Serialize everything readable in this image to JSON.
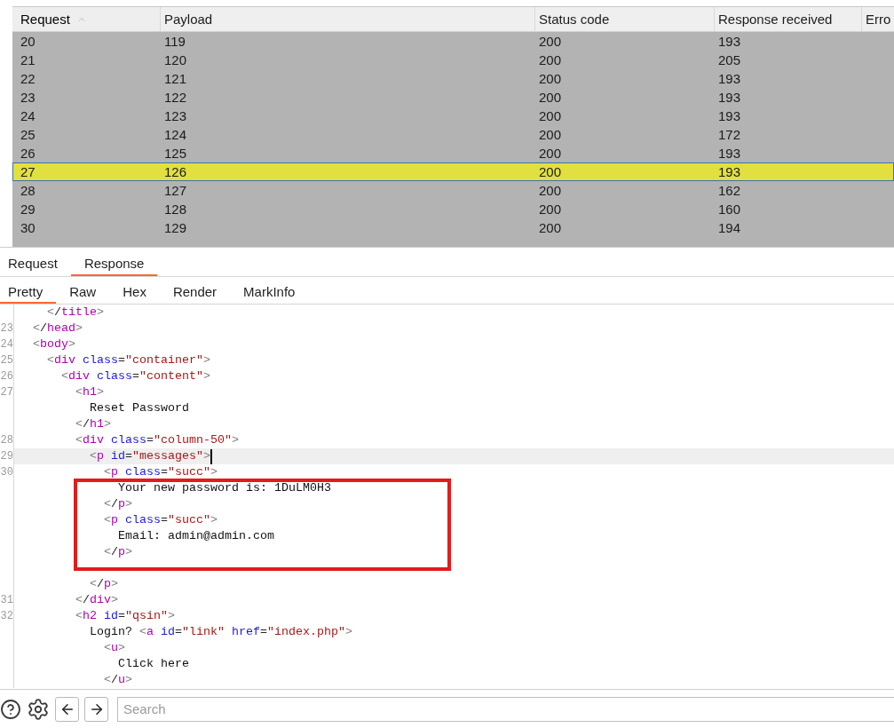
{
  "table": {
    "columns": [
      {
        "label": "Request",
        "sorted": true
      },
      {
        "label": "Payload",
        "sorted": false
      },
      {
        "label": "Status code",
        "sorted": false
      },
      {
        "label": "Response received",
        "sorted": false
      },
      {
        "label": "Erro",
        "sorted": false
      }
    ],
    "rows": [
      {
        "cells": [
          "20",
          "119",
          "200",
          "193"
        ],
        "selected": false
      },
      {
        "cells": [
          "21",
          "120",
          "200",
          "205"
        ],
        "selected": false
      },
      {
        "cells": [
          "22",
          "121",
          "200",
          "193"
        ],
        "selected": false
      },
      {
        "cells": [
          "23",
          "122",
          "200",
          "193"
        ],
        "selected": false
      },
      {
        "cells": [
          "24",
          "123",
          "200",
          "193"
        ],
        "selected": false
      },
      {
        "cells": [
          "25",
          "124",
          "200",
          "172"
        ],
        "selected": false
      },
      {
        "cells": [
          "26",
          "125",
          "200",
          "193"
        ],
        "selected": false
      },
      {
        "cells": [
          "27",
          "126",
          "200",
          "193"
        ],
        "selected": true
      },
      {
        "cells": [
          "28",
          "127",
          "200",
          "162"
        ],
        "selected": false
      },
      {
        "cells": [
          "29",
          "128",
          "200",
          "160"
        ],
        "selected": false
      },
      {
        "cells": [
          "30",
          "129",
          "200",
          "194"
        ],
        "selected": false
      }
    ]
  },
  "tabs": [
    {
      "label": "Request",
      "selected": false
    },
    {
      "label": "Response",
      "selected": true
    }
  ],
  "view_tabs": [
    {
      "label": "Pretty",
      "selected": true
    },
    {
      "label": "Raw",
      "selected": false
    },
    {
      "label": "Hex",
      "selected": false
    },
    {
      "label": "Render",
      "selected": false
    },
    {
      "label": "MarkInfo",
      "selected": false
    }
  ],
  "editor": {
    "lines": [
      {
        "tokens": [
          {
            "kind": "bracket",
            "text": "    <"
          },
          {
            "kind": "punct",
            "text": "/"
          },
          {
            "kind": "tag",
            "text": "title"
          },
          {
            "kind": "bracket",
            "text": ">"
          }
        ],
        "current": false
      },
      {
        "number": "23",
        "tokens": [
          {
            "kind": "bracket",
            "text": "  <"
          },
          {
            "kind": "punct",
            "text": "/"
          },
          {
            "kind": "tag",
            "text": "head"
          },
          {
            "kind": "bracket",
            "text": ">"
          }
        ],
        "current": false
      },
      {
        "number": "24",
        "tokens": [
          {
            "kind": "bracket",
            "text": "  <"
          },
          {
            "kind": "tag",
            "text": "body"
          },
          {
            "kind": "bracket",
            "text": ">"
          }
        ],
        "current": false
      },
      {
        "number": "25",
        "tokens": [
          {
            "kind": "bracket",
            "text": "    <"
          },
          {
            "kind": "tag",
            "text": "div"
          },
          {
            "kind": "attr",
            "text": " class"
          },
          {
            "kind": "punct",
            "text": "="
          },
          {
            "kind": "value",
            "text": "\"container\""
          },
          {
            "kind": "bracket",
            "text": ">"
          }
        ],
        "current": false
      },
      {
        "number": "26",
        "tokens": [
          {
            "kind": "bracket",
            "text": "      <"
          },
          {
            "kind": "tag",
            "text": "div"
          },
          {
            "kind": "attr",
            "text": " class"
          },
          {
            "kind": "punct",
            "text": "="
          },
          {
            "kind": "value",
            "text": "\"content\""
          },
          {
            "kind": "bracket",
            "text": ">"
          }
        ],
        "current": false
      },
      {
        "number": "27",
        "tokens": [
          {
            "kind": "bracket",
            "text": "        <"
          },
          {
            "kind": "tag",
            "text": "h1"
          },
          {
            "kind": "bracket",
            "text": ">"
          }
        ],
        "current": false
      },
      {
        "tokens": [
          {
            "kind": "text",
            "text": "          Reset Password"
          }
        ],
        "current": false
      },
      {
        "tokens": [
          {
            "kind": "bracket",
            "text": "        <"
          },
          {
            "kind": "punct",
            "text": "/"
          },
          {
            "kind": "tag",
            "text": "h1"
          },
          {
            "kind": "bracket",
            "text": ">"
          }
        ],
        "current": false
      },
      {
        "number": "28",
        "tokens": [
          {
            "kind": "bracket",
            "text": "        <"
          },
          {
            "kind": "tag",
            "text": "div"
          },
          {
            "kind": "attr",
            "text": " class"
          },
          {
            "kind": "punct",
            "text": "="
          },
          {
            "kind": "value",
            "text": "\"column-50\""
          },
          {
            "kind": "bracket",
            "text": ">"
          }
        ],
        "current": false
      },
      {
        "number": "29",
        "tokens": [
          {
            "kind": "bracket",
            "text": "          <"
          },
          {
            "kind": "tag",
            "text": "p"
          },
          {
            "kind": "attr",
            "text": " id"
          },
          {
            "kind": "punct",
            "text": "="
          },
          {
            "kind": "value",
            "text": "\"messages\""
          },
          {
            "kind": "bracket",
            "text": ">"
          }
        ],
        "current": true
      },
      {
        "number": "30",
        "tokens": [
          {
            "kind": "bracket",
            "text": "            <"
          },
          {
            "kind": "tag",
            "text": "p"
          },
          {
            "kind": "attr",
            "text": " class"
          },
          {
            "kind": "punct",
            "text": "="
          },
          {
            "kind": "value",
            "text": "\"succ\""
          },
          {
            "kind": "bracket",
            "text": ">"
          }
        ],
        "current": false
      },
      {
        "tokens": [
          {
            "kind": "text",
            "text": "              Your new password is: 1DuLM0H3"
          }
        ],
        "current": false
      },
      {
        "tokens": [
          {
            "kind": "bracket",
            "text": "            <"
          },
          {
            "kind": "punct",
            "text": "/"
          },
          {
            "kind": "tag",
            "text": "p"
          },
          {
            "kind": "bracket",
            "text": ">"
          }
        ],
        "current": false
      },
      {
        "tokens": [
          {
            "kind": "bracket",
            "text": "            <"
          },
          {
            "kind": "tag",
            "text": "p"
          },
          {
            "kind": "attr",
            "text": " class"
          },
          {
            "kind": "punct",
            "text": "="
          },
          {
            "kind": "value",
            "text": "\"succ\""
          },
          {
            "kind": "bracket",
            "text": ">"
          }
        ],
        "current": false
      },
      {
        "tokens": [
          {
            "kind": "text",
            "text": "              Email: admin@admin.com"
          }
        ],
        "current": false
      },
      {
        "tokens": [
          {
            "kind": "bracket",
            "text": "            <"
          },
          {
            "kind": "punct",
            "text": "/"
          },
          {
            "kind": "tag",
            "text": "p"
          },
          {
            "kind": "bracket",
            "text": ">"
          }
        ],
        "current": false
      },
      {
        "current": false
      },
      {
        "tokens": [
          {
            "kind": "bracket",
            "text": "          <"
          },
          {
            "kind": "punct",
            "text": "/"
          },
          {
            "kind": "tag",
            "text": "p"
          },
          {
            "kind": "bracket",
            "text": ">"
          }
        ],
        "current": false
      },
      {
        "number": "31",
        "tokens": [
          {
            "kind": "bracket",
            "text": "        <"
          },
          {
            "kind": "punct",
            "text": "/"
          },
          {
            "kind": "tag",
            "text": "div"
          },
          {
            "kind": "bracket",
            "text": ">"
          }
        ],
        "current": false
      },
      {
        "number": "32",
        "tokens": [
          {
            "kind": "bracket",
            "text": "        <"
          },
          {
            "kind": "tag",
            "text": "h2"
          },
          {
            "kind": "attr",
            "text": " id"
          },
          {
            "kind": "punct",
            "text": "="
          },
          {
            "kind": "value",
            "text": "\"qsin\""
          },
          {
            "kind": "bracket",
            "text": ">"
          }
        ],
        "current": false
      },
      {
        "tokens": [
          {
            "kind": "text",
            "text": "          Login? "
          },
          {
            "kind": "bracket",
            "text": "<"
          },
          {
            "kind": "tag",
            "text": "a"
          },
          {
            "kind": "attr",
            "text": " id"
          },
          {
            "kind": "punct",
            "text": "="
          },
          {
            "kind": "value",
            "text": "\"link\""
          },
          {
            "kind": "attr",
            "text": " href"
          },
          {
            "kind": "punct",
            "text": "="
          },
          {
            "kind": "value",
            "text": "\"index.php\""
          },
          {
            "kind": "bracket",
            "text": ">"
          }
        ],
        "current": false
      },
      {
        "tokens": [
          {
            "kind": "bracket",
            "text": "            <"
          },
          {
            "kind": "tag",
            "text": "u"
          },
          {
            "kind": "bracket",
            "text": ">"
          }
        ],
        "current": false
      },
      {
        "tokens": [
          {
            "kind": "text",
            "text": "              Click here"
          }
        ],
        "current": false
      },
      {
        "tokens": [
          {
            "kind": "bracket",
            "text": "            <"
          },
          {
            "kind": "punct",
            "text": "/"
          },
          {
            "kind": "tag",
            "text": "u"
          },
          {
            "kind": "bracket",
            "text": ">"
          }
        ],
        "current": false
      }
    ]
  },
  "search": {
    "placeholder": "Search"
  }
}
